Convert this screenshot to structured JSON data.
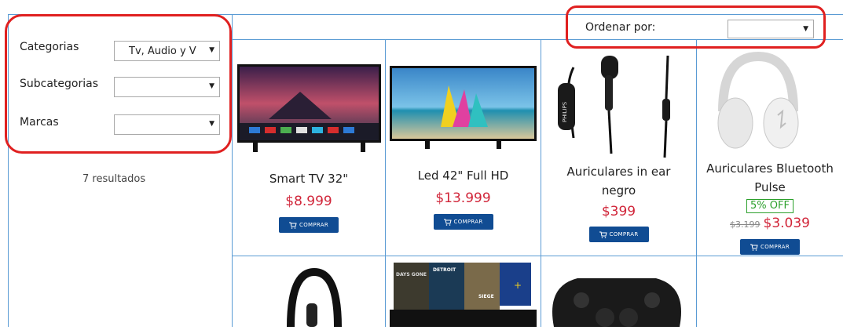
{
  "filters": {
    "category": {
      "label": "Categorias",
      "value": "Tv, Audio y V"
    },
    "subcategory": {
      "label": "Subcategorias",
      "value": ""
    },
    "brand": {
      "label": "Marcas",
      "value": ""
    }
  },
  "results_text": "7 resultados",
  "sort": {
    "label": "Ordenar por:",
    "value": ""
  },
  "products": [
    {
      "name": "Smart TV 32\"",
      "price": "$8.999",
      "buy_label": "COMPRAR"
    },
    {
      "name": "Led 42\" Full HD",
      "price": "$13.999",
      "buy_label": "COMPRAR"
    },
    {
      "name_line1": "Auriculares in ear",
      "name_line2": "negro",
      "price": "$399",
      "buy_label": "COMPRAR"
    },
    {
      "name_line1": "Auriculares Bluetooth",
      "name_line2": "Pulse",
      "discount": "5% OFF",
      "old_price": "$3.199",
      "price": "$3.039",
      "buy_label": "COMPRAR"
    }
  ],
  "image_text": {
    "earphones_brand": "PHILIPS",
    "game1": "DAYS GONE",
    "game2": "DETROIT",
    "game3": "SIEGE"
  },
  "colors": {
    "accent_blue": "#104c93",
    "price_red": "#d1263a",
    "grid_blue": "#5a9bd4",
    "highlight_red": "#e02020"
  }
}
